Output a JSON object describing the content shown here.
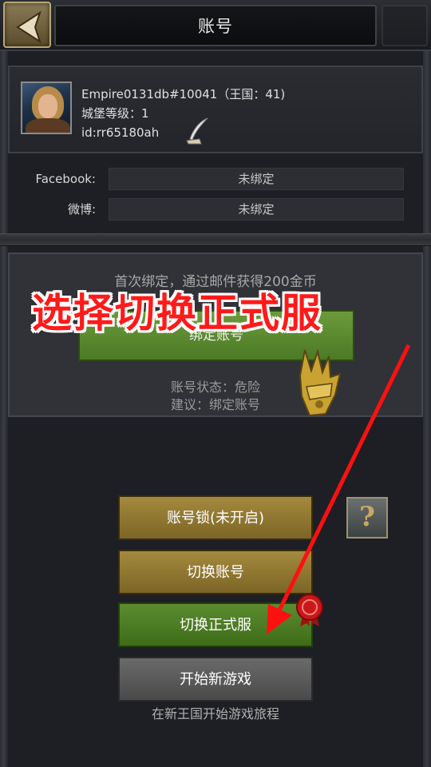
{
  "header": {
    "title": "账号",
    "back_icon": "back-arrow-icon"
  },
  "profile": {
    "name_line": "Empire0131db#10041（王国：41)",
    "castle_level": "城堡等级：1",
    "id_line": "id:rr65180ah",
    "edit_icon": "quill-icon"
  },
  "bindings": [
    {
      "label": "Facebook:",
      "value": "未绑定"
    },
    {
      "label": "微博:",
      "value": "未绑定"
    }
  ],
  "bind_section": {
    "note": "首次绑定，通过邮件获得200金币",
    "button_label": "绑定账号",
    "status": "账号状态：危险",
    "advice": "建议：绑定账号"
  },
  "overlay_instruction": "选择切换正式服",
  "buttons": {
    "account_lock": "账号锁(未开启)",
    "switch_account": "切换账号",
    "switch_official": "切换正式服",
    "new_game": "开始新游戏",
    "help": "?"
  },
  "footer_note": "在新王国开始游戏旅程",
  "colors": {
    "gold_button": "#a48a3e",
    "green_button": "#5b8c2e",
    "gray_button": "#6a6a6a",
    "overlay_red": "#ff1a1a"
  }
}
